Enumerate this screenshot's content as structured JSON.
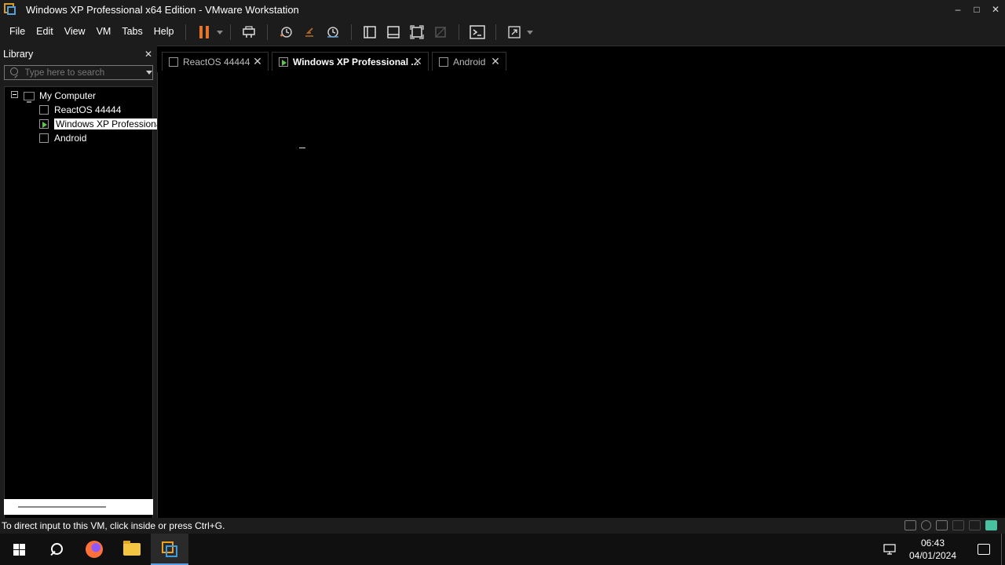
{
  "window": {
    "title": "Windows XP Professional x64 Edition - VMware Workstation",
    "minimize": "–",
    "maximize": "□",
    "close": "✕"
  },
  "menu": {
    "items": [
      "File",
      "Edit",
      "View",
      "VM",
      "Tabs",
      "Help"
    ]
  },
  "toolbar": {
    "icons": [
      "pause-icon",
      "send-ctrl-alt-del-icon",
      "snapshot-icon",
      "revert-snapshot-icon",
      "snapshot-manager-icon",
      "show-library-icon",
      "show-thumbnail-bar-icon",
      "fit-guest-icon",
      "unity-icon",
      "console-view-icon",
      "full-screen-icon"
    ],
    "accent_color": "#e8742b"
  },
  "library": {
    "title": "Library",
    "close": "✕",
    "search_placeholder": "Type here to search",
    "tree": {
      "root": "My Computer",
      "vms": [
        {
          "name": "ReactOS 44444",
          "running": false,
          "selected": false
        },
        {
          "name": "Windows XP Professiona",
          "running": true,
          "selected": true
        },
        {
          "name": "Android",
          "running": false,
          "selected": false
        }
      ]
    }
  },
  "tabs": [
    {
      "label": "ReactOS 44444",
      "active": false
    },
    {
      "label": "Windows XP Professional ...",
      "active": true
    },
    {
      "label": "Android",
      "active": false
    }
  ],
  "status": {
    "message": "To direct input to this VM, click inside or press Ctrl+G."
  },
  "taskbar": {
    "apps": [
      "firefox-icon",
      "file-explorer-icon",
      "vmware-workstation-icon"
    ],
    "time": "06:43",
    "date": "04/01/2024"
  }
}
